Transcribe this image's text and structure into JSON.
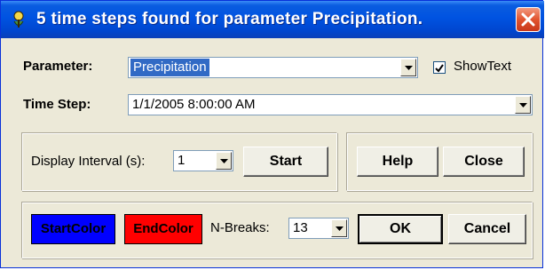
{
  "window": {
    "title": "5 time steps found for parameter Precipitation."
  },
  "parameter": {
    "label": "Parameter:",
    "value": "Precipitation",
    "showtext_label": "ShowText",
    "showtext_checked": true
  },
  "timestep": {
    "label": "Time Step:",
    "value": "1/1/2005 8:00:00 AM"
  },
  "display": {
    "label": "Display Interval (s):",
    "value": "1",
    "start_label": "Start"
  },
  "actions": {
    "help_label": "Help",
    "close_label": "Close"
  },
  "colors": {
    "start_label": "StartColor",
    "start_color": "#0000ff",
    "end_label": "EndColor",
    "end_color": "#ff0000"
  },
  "breaks": {
    "label": "N-Breaks:",
    "value": "13"
  },
  "footer": {
    "ok_label": "OK",
    "cancel_label": "Cancel"
  }
}
